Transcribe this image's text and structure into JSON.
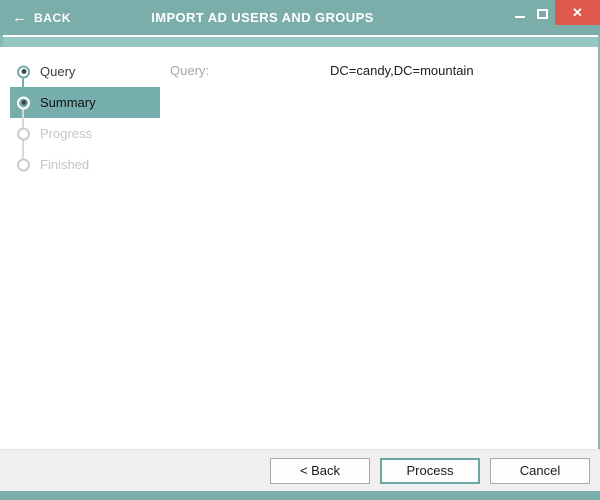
{
  "titlebar": {
    "back_arrow": "←",
    "back_label": "BACK",
    "title": "IMPORT AD USERS AND GROUPS",
    "close_glyph": "✕"
  },
  "stepper": {
    "steps": [
      {
        "label": "Query",
        "state": "done"
      },
      {
        "label": "Summary",
        "state": "active"
      },
      {
        "label": "Progress",
        "state": "pending"
      },
      {
        "label": "Finished",
        "state": "pending"
      }
    ]
  },
  "content": {
    "fields": [
      {
        "label": "Query:",
        "value": "DC=candy,DC=mountain"
      }
    ]
  },
  "footer": {
    "buttons": [
      {
        "label": "< Back"
      },
      {
        "label": "Process"
      },
      {
        "label": "Cancel"
      }
    ]
  },
  "colors": {
    "header_teal": "#7badaa",
    "band_teal": "#94c6c3",
    "accent_teal": "#76aead",
    "left_strip_teal": "#86b8b5",
    "close_red": "#e0584c",
    "footer_gray": "#f0f0f0"
  }
}
